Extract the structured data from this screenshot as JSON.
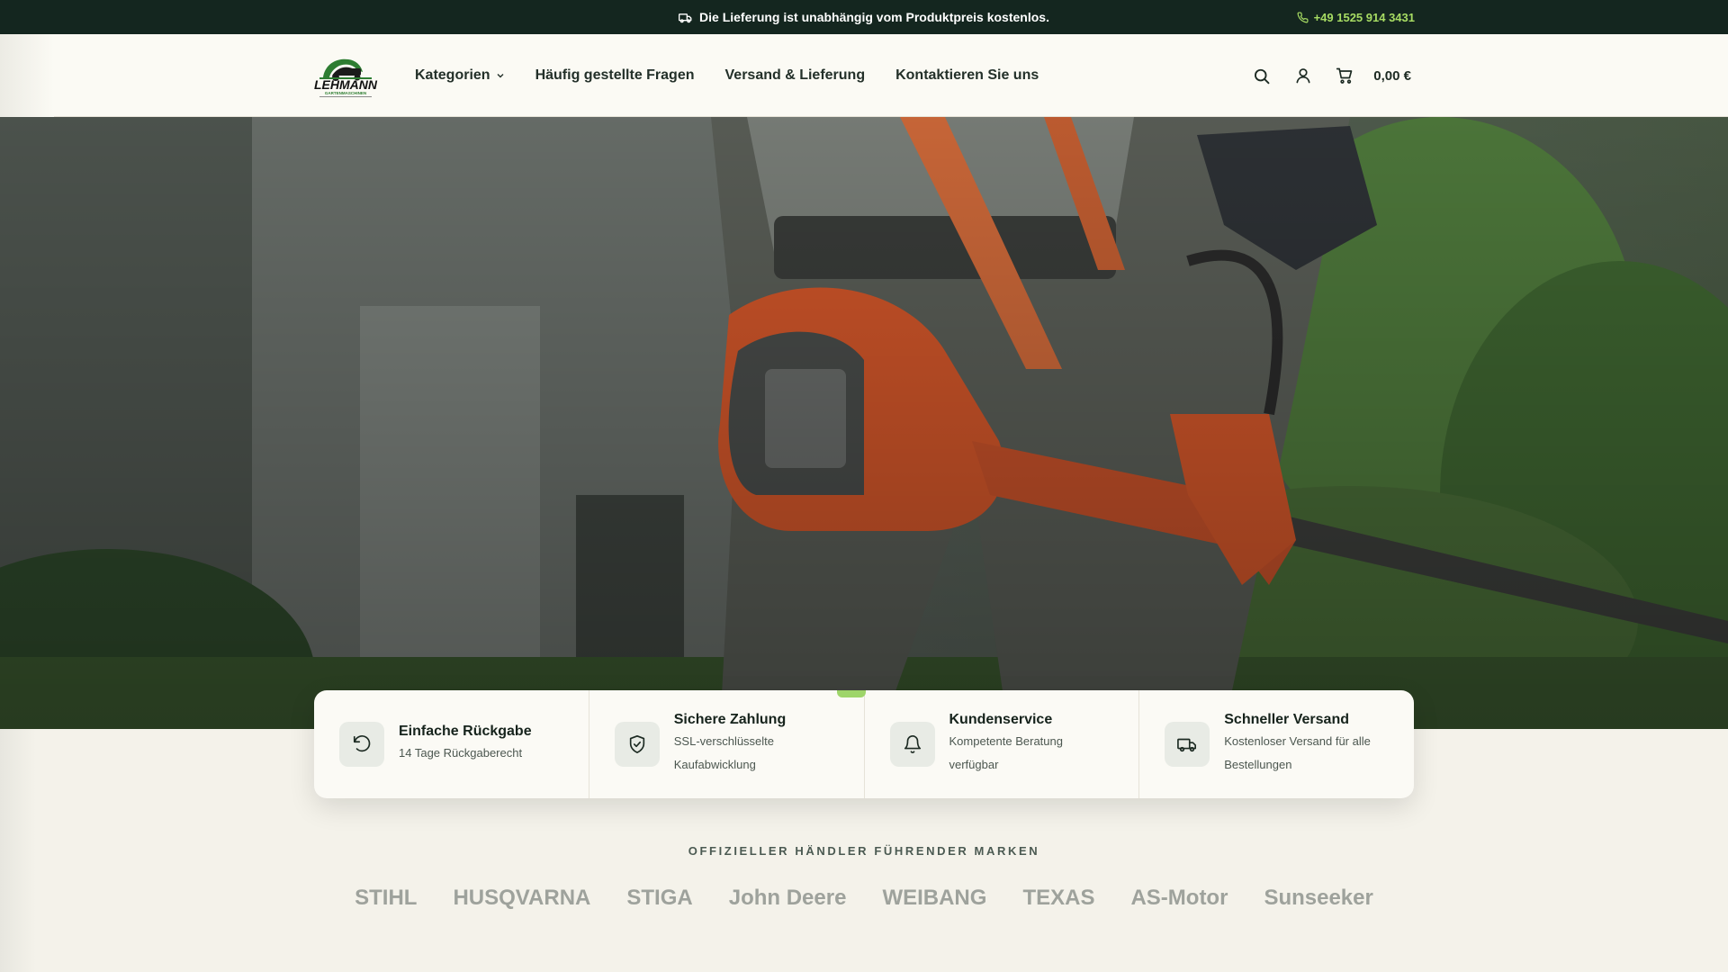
{
  "topbar": {
    "shipping_notice": "Die Lieferung ist unabhängig vom Produktpreis kostenlos.",
    "phone": "+49 1525 914 3431",
    "truck_icon": "truck-icon",
    "phone_icon": "phone-icon"
  },
  "header": {
    "logo_text": "LEHMANN",
    "logo_subtitle": "GARTENMASCHINEN",
    "nav": [
      {
        "label": "Kategorien",
        "has_dropdown": true
      },
      {
        "label": "Häufig gestellte Fragen"
      },
      {
        "label": "Versand & Lieferung"
      },
      {
        "label": "Kontaktieren Sie uns"
      }
    ],
    "icons": [
      "search-icon",
      "user-icon",
      "cart-icon"
    ],
    "cart_total": "0,00 €"
  },
  "features": [
    {
      "title": "Einfache Rückgabe",
      "subtitle": "14 Tage Rückgaberecht",
      "icon": "rotate-ccw-icon"
    },
    {
      "title": "Sichere Zahlung",
      "subtitle": "SSL-verschlüsselte Kaufabwicklung",
      "icon": "shield-check-icon"
    },
    {
      "title": "Kundenservice",
      "subtitle": "Kompetente Beratung verfügbar",
      "icon": "bell-icon"
    },
    {
      "title": "Schneller Versand",
      "subtitle": "Kostenloser Versand für alle Bestellungen",
      "icon": "truck-icon"
    }
  ],
  "brands": {
    "label": "OFFIZIELLER HÄNDLER FÜHRENDER MARKEN",
    "items": [
      "STIHL",
      "HUSQVARNA",
      "STIGA",
      "John Deere",
      "WEIBANG",
      "TEXAS",
      "AS-Motor",
      "Sunseeker"
    ]
  },
  "colors": {
    "topbar_bg": "#14261f",
    "accent_green": "#a7dc63",
    "page_bg": "#f4f2ea",
    "header_bg": "#fbfaf4",
    "machine_orange": "#d4572a"
  }
}
